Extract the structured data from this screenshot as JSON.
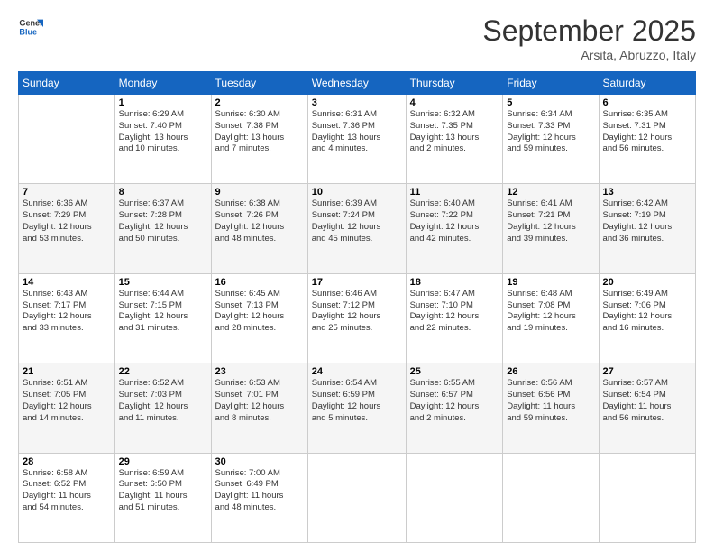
{
  "header": {
    "logo_general": "General",
    "logo_blue": "Blue",
    "month_title": "September 2025",
    "location": "Arsita, Abruzzo, Italy"
  },
  "days_of_week": [
    "Sunday",
    "Monday",
    "Tuesday",
    "Wednesday",
    "Thursday",
    "Friday",
    "Saturday"
  ],
  "weeks": [
    [
      {
        "day": "",
        "info": ""
      },
      {
        "day": "1",
        "info": "Sunrise: 6:29 AM\nSunset: 7:40 PM\nDaylight: 13 hours\nand 10 minutes."
      },
      {
        "day": "2",
        "info": "Sunrise: 6:30 AM\nSunset: 7:38 PM\nDaylight: 13 hours\nand 7 minutes."
      },
      {
        "day": "3",
        "info": "Sunrise: 6:31 AM\nSunset: 7:36 PM\nDaylight: 13 hours\nand 4 minutes."
      },
      {
        "day": "4",
        "info": "Sunrise: 6:32 AM\nSunset: 7:35 PM\nDaylight: 13 hours\nand 2 minutes."
      },
      {
        "day": "5",
        "info": "Sunrise: 6:34 AM\nSunset: 7:33 PM\nDaylight: 12 hours\nand 59 minutes."
      },
      {
        "day": "6",
        "info": "Sunrise: 6:35 AM\nSunset: 7:31 PM\nDaylight: 12 hours\nand 56 minutes."
      }
    ],
    [
      {
        "day": "7",
        "info": "Sunrise: 6:36 AM\nSunset: 7:29 PM\nDaylight: 12 hours\nand 53 minutes."
      },
      {
        "day": "8",
        "info": "Sunrise: 6:37 AM\nSunset: 7:28 PM\nDaylight: 12 hours\nand 50 minutes."
      },
      {
        "day": "9",
        "info": "Sunrise: 6:38 AM\nSunset: 7:26 PM\nDaylight: 12 hours\nand 48 minutes."
      },
      {
        "day": "10",
        "info": "Sunrise: 6:39 AM\nSunset: 7:24 PM\nDaylight: 12 hours\nand 45 minutes."
      },
      {
        "day": "11",
        "info": "Sunrise: 6:40 AM\nSunset: 7:22 PM\nDaylight: 12 hours\nand 42 minutes."
      },
      {
        "day": "12",
        "info": "Sunrise: 6:41 AM\nSunset: 7:21 PM\nDaylight: 12 hours\nand 39 minutes."
      },
      {
        "day": "13",
        "info": "Sunrise: 6:42 AM\nSunset: 7:19 PM\nDaylight: 12 hours\nand 36 minutes."
      }
    ],
    [
      {
        "day": "14",
        "info": "Sunrise: 6:43 AM\nSunset: 7:17 PM\nDaylight: 12 hours\nand 33 minutes."
      },
      {
        "day": "15",
        "info": "Sunrise: 6:44 AM\nSunset: 7:15 PM\nDaylight: 12 hours\nand 31 minutes."
      },
      {
        "day": "16",
        "info": "Sunrise: 6:45 AM\nSunset: 7:13 PM\nDaylight: 12 hours\nand 28 minutes."
      },
      {
        "day": "17",
        "info": "Sunrise: 6:46 AM\nSunset: 7:12 PM\nDaylight: 12 hours\nand 25 minutes."
      },
      {
        "day": "18",
        "info": "Sunrise: 6:47 AM\nSunset: 7:10 PM\nDaylight: 12 hours\nand 22 minutes."
      },
      {
        "day": "19",
        "info": "Sunrise: 6:48 AM\nSunset: 7:08 PM\nDaylight: 12 hours\nand 19 minutes."
      },
      {
        "day": "20",
        "info": "Sunrise: 6:49 AM\nSunset: 7:06 PM\nDaylight: 12 hours\nand 16 minutes."
      }
    ],
    [
      {
        "day": "21",
        "info": "Sunrise: 6:51 AM\nSunset: 7:05 PM\nDaylight: 12 hours\nand 14 minutes."
      },
      {
        "day": "22",
        "info": "Sunrise: 6:52 AM\nSunset: 7:03 PM\nDaylight: 12 hours\nand 11 minutes."
      },
      {
        "day": "23",
        "info": "Sunrise: 6:53 AM\nSunset: 7:01 PM\nDaylight: 12 hours\nand 8 minutes."
      },
      {
        "day": "24",
        "info": "Sunrise: 6:54 AM\nSunset: 6:59 PM\nDaylight: 12 hours\nand 5 minutes."
      },
      {
        "day": "25",
        "info": "Sunrise: 6:55 AM\nSunset: 6:57 PM\nDaylight: 12 hours\nand 2 minutes."
      },
      {
        "day": "26",
        "info": "Sunrise: 6:56 AM\nSunset: 6:56 PM\nDaylight: 11 hours\nand 59 minutes."
      },
      {
        "day": "27",
        "info": "Sunrise: 6:57 AM\nSunset: 6:54 PM\nDaylight: 11 hours\nand 56 minutes."
      }
    ],
    [
      {
        "day": "28",
        "info": "Sunrise: 6:58 AM\nSunset: 6:52 PM\nDaylight: 11 hours\nand 54 minutes."
      },
      {
        "day": "29",
        "info": "Sunrise: 6:59 AM\nSunset: 6:50 PM\nDaylight: 11 hours\nand 51 minutes."
      },
      {
        "day": "30",
        "info": "Sunrise: 7:00 AM\nSunset: 6:49 PM\nDaylight: 11 hours\nand 48 minutes."
      },
      {
        "day": "",
        "info": ""
      },
      {
        "day": "",
        "info": ""
      },
      {
        "day": "",
        "info": ""
      },
      {
        "day": "",
        "info": ""
      }
    ]
  ]
}
